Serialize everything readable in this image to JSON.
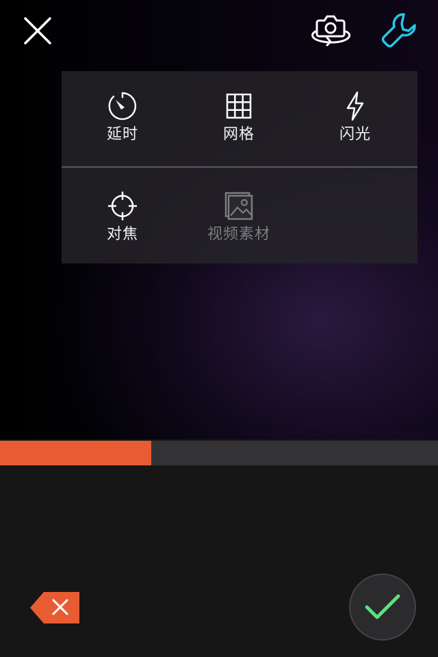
{
  "colors": {
    "accent": "#e85c33",
    "settings_active": "#27c6e6",
    "confirm": "#5ee07c",
    "icon": "#ffffff",
    "disabled": "#7d7d80"
  },
  "top_bar": {
    "close_icon": "close-icon",
    "flip_icon": "camera-flip-icon",
    "settings_icon": "wrench-icon"
  },
  "menu": {
    "items": [
      {
        "label": "延时",
        "icon": "timer-icon",
        "enabled": true
      },
      {
        "label": "网格",
        "icon": "grid-icon",
        "enabled": true
      },
      {
        "label": "闪光",
        "icon": "flash-icon",
        "enabled": true
      },
      {
        "label": "对焦",
        "icon": "focus-icon",
        "enabled": true
      },
      {
        "label": "视频素材",
        "icon": "video-material-icon",
        "enabled": false
      }
    ]
  },
  "recording": {
    "progress": 0.345
  },
  "bottom_bar": {
    "delete_icon": "delete-segment-icon",
    "confirm_icon": "checkmark-icon"
  }
}
